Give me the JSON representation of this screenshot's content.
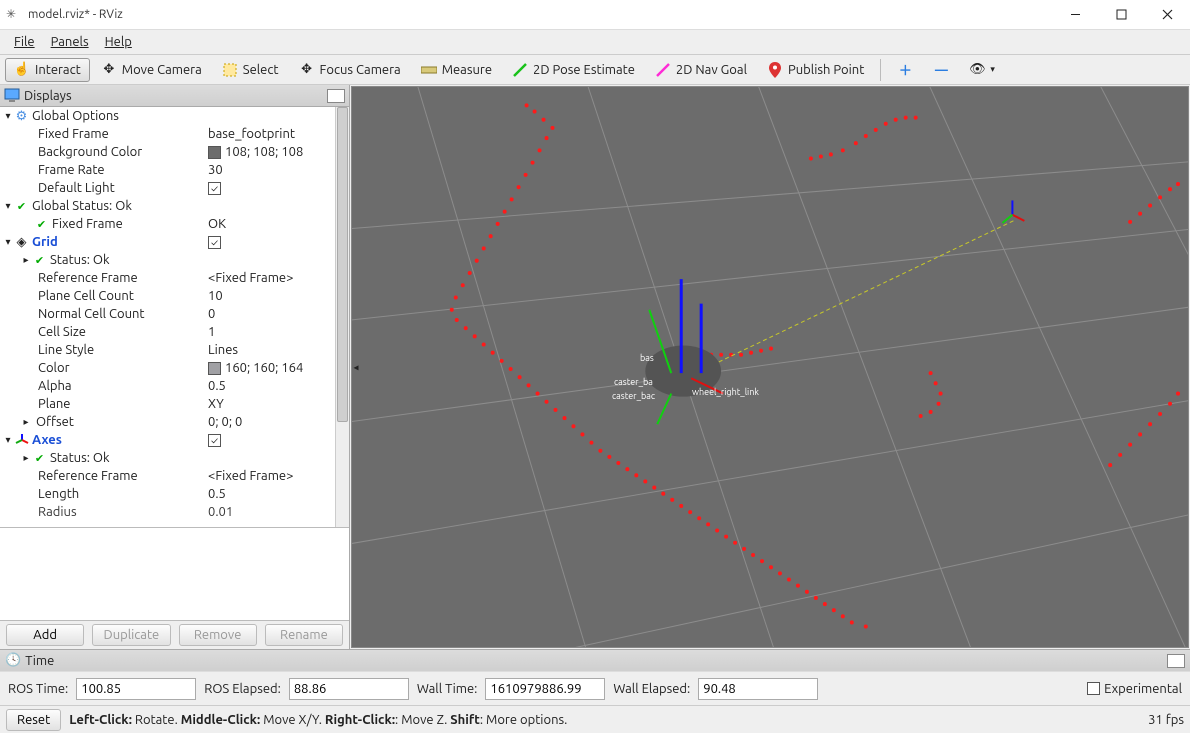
{
  "window": {
    "title": "model.rviz* - RViz"
  },
  "menu": {
    "file": "File",
    "panels": "Panels",
    "help": "Help"
  },
  "toolbar": {
    "interact": "Interact",
    "move_camera": "Move Camera",
    "select": "Select",
    "focus_camera": "Focus Camera",
    "measure": "Measure",
    "pose_estimate": "2D Pose Estimate",
    "nav_goal": "2D Nav Goal",
    "publish_point": "Publish Point"
  },
  "displays": {
    "header": "Displays",
    "global_options": {
      "label": "Global Options",
      "fixed_frame_k": "Fixed Frame",
      "fixed_frame_v": "base_footprint",
      "bg_k": "Background Color",
      "bg_v": "108; 108; 108",
      "bg_hex": "#6c6c6c",
      "frame_rate_k": "Frame Rate",
      "frame_rate_v": "30",
      "default_light_k": "Default Light",
      "default_light_v": true
    },
    "global_status": {
      "label": "Global Status: Ok",
      "fixed_frame_k": "Fixed Frame",
      "fixed_frame_v": "OK"
    },
    "grid": {
      "label": "Grid",
      "status_k": "Status: Ok",
      "ref_k": "Reference Frame",
      "ref_v": "<Fixed Frame>",
      "plane_cell_k": "Plane Cell Count",
      "plane_cell_v": "10",
      "normal_cell_k": "Normal Cell Count",
      "normal_cell_v": "0",
      "cell_size_k": "Cell Size",
      "cell_size_v": "1",
      "line_style_k": "Line Style",
      "line_style_v": "Lines",
      "color_k": "Color",
      "color_v": "160; 160; 164",
      "color_hex": "#a0a0a4",
      "alpha_k": "Alpha",
      "alpha_v": "0.5",
      "plane_k": "Plane",
      "plane_v": "XY",
      "offset_k": "Offset",
      "offset_v": "0; 0; 0"
    },
    "axes": {
      "label": "Axes",
      "status_k": "Status: Ok",
      "ref_k": "Reference Frame",
      "ref_v": "<Fixed Frame>",
      "length_k": "Length",
      "length_v": "0.5",
      "radius_k": "Radius",
      "radius_v": "0.01"
    }
  },
  "buttons": {
    "add": "Add",
    "duplicate": "Duplicate",
    "remove": "Remove",
    "rename": "Rename"
  },
  "view3d_labels": {
    "a": "bas",
    "b": "caster_ba",
    "c": "caster_bac",
    "d": "wheel_right_link"
  },
  "time": {
    "header": "Time",
    "ros_time_k": "ROS Time:",
    "ros_time_v": "100.85",
    "ros_elapsed_k": "ROS Elapsed:",
    "ros_elapsed_v": "88.86",
    "wall_time_k": "Wall Time:",
    "wall_time_v": "1610979886.99",
    "wall_elapsed_k": "Wall Elapsed:",
    "wall_elapsed_v": "90.48",
    "experimental": "Experimental"
  },
  "status": {
    "reset": "Reset",
    "hints_html": "Left-Click: Rotate. Middle-Click: Move X/Y. Right-Click:: Move Z. Shift: More options.",
    "lc": "Left-Click:",
    "lc_t": " Rotate. ",
    "mc": "Middle-Click:",
    "mc_t": " Move X/Y. ",
    "rc": "Right-Click:",
    "rc_t": ": Move Z. ",
    "sh": "Shift",
    "sh_t": ": More options.",
    "fps": "31 fps"
  }
}
